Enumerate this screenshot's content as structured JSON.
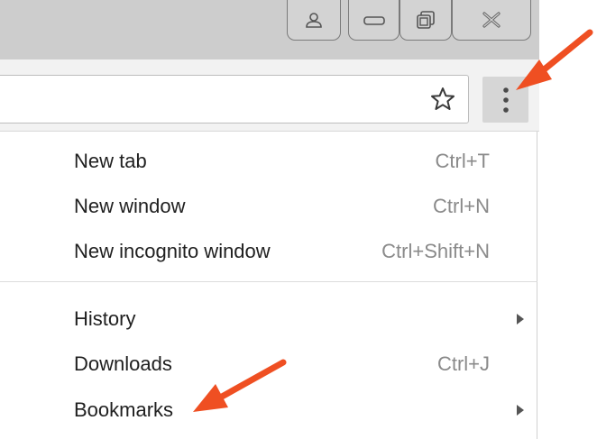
{
  "window": {
    "buttons": [
      {
        "name": "profile-button",
        "icon": "person-icon"
      },
      {
        "name": "minimize-button",
        "icon": "minimize-icon"
      },
      {
        "name": "restore-button",
        "icon": "restore-icon"
      },
      {
        "name": "close-button",
        "icon": "close-icon"
      }
    ]
  },
  "toolbar": {
    "bookmark_icon": "star-icon",
    "menu_icon": "vertical-dots-icon"
  },
  "menu": {
    "items": [
      {
        "label": "New tab",
        "shortcut": "Ctrl+T"
      },
      {
        "label": "New window",
        "shortcut": "Ctrl+N"
      },
      {
        "label": "New incognito window",
        "shortcut": "Ctrl+Shift+N"
      },
      {
        "label": "History",
        "shortcut": "",
        "submenu": true
      },
      {
        "label": "Downloads",
        "shortcut": "Ctrl+J"
      },
      {
        "label": "Bookmarks",
        "shortcut": "",
        "submenu": true
      }
    ]
  },
  "colors": {
    "annotation_arrow": "#ef4f22",
    "titlebar": "#cdcdcd",
    "toolbar": "#f2f2f2",
    "shortcut_text": "#8a8a8a"
  }
}
